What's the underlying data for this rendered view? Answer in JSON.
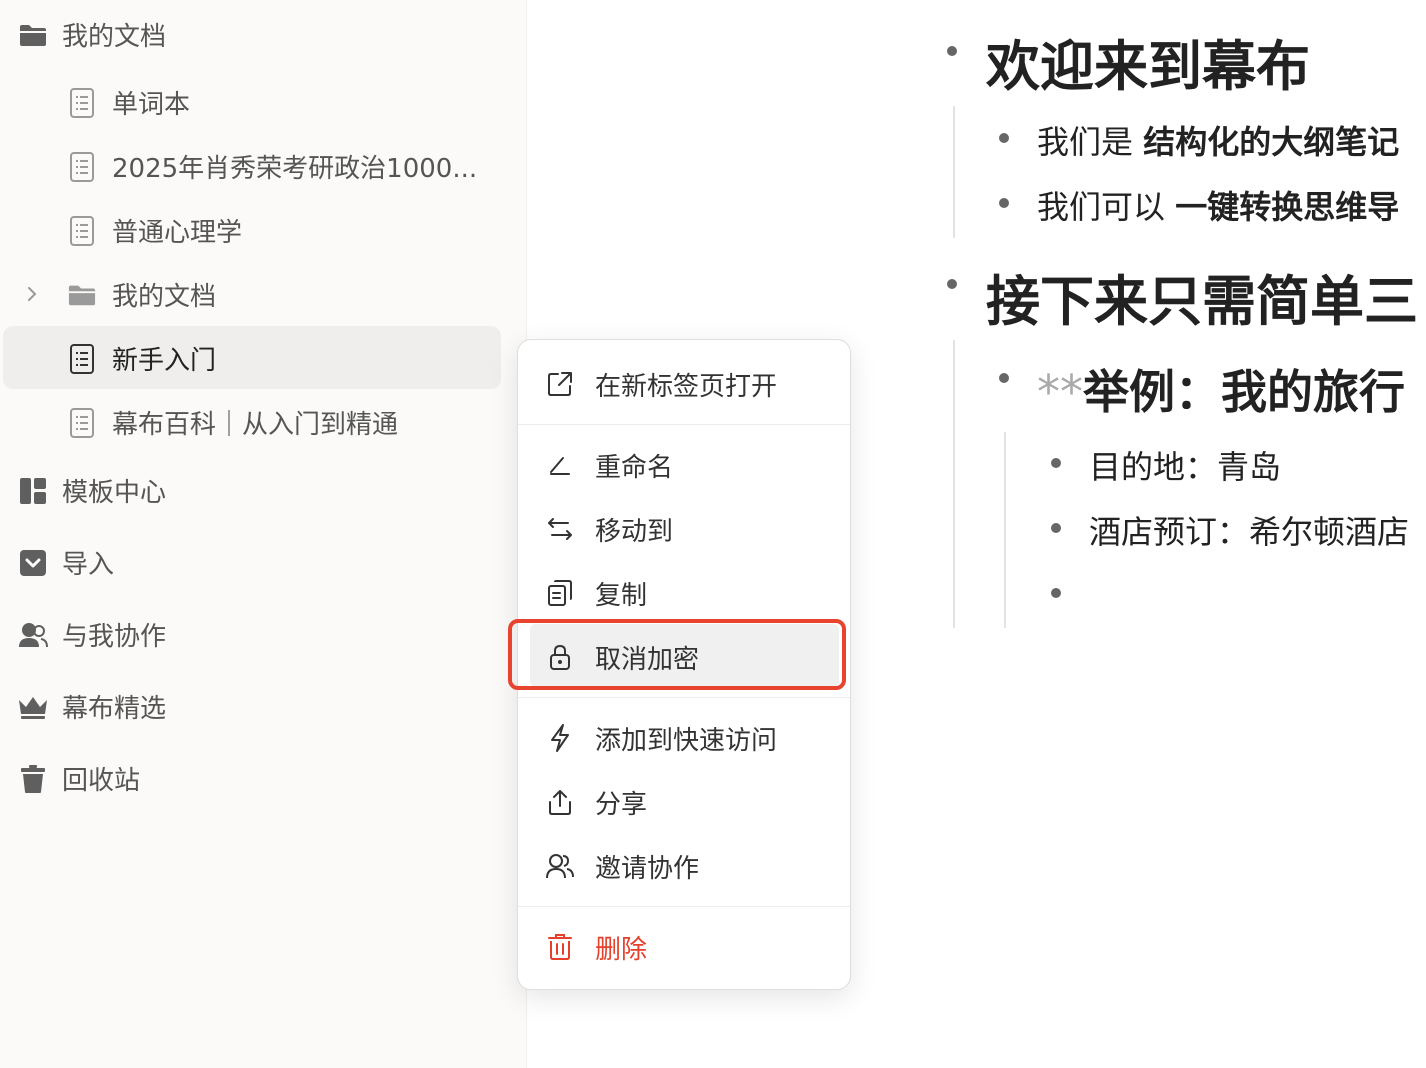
{
  "sidebar": {
    "root_folder": "我的文档",
    "children": [
      {
        "label": "单词本",
        "type": "doc"
      },
      {
        "label": "2025年肖秀荣考研政治1000...",
        "type": "doc"
      },
      {
        "label": "普通心理学",
        "type": "doc"
      },
      {
        "label": "我的文档",
        "type": "folder"
      },
      {
        "label": "新手入门",
        "type": "doc",
        "active": true
      },
      {
        "label": "幕布百科｜从入门到精通",
        "type": "doc"
      }
    ],
    "nav": [
      {
        "label": "模板中心",
        "icon": "template-icon"
      },
      {
        "label": "导入",
        "icon": "import-icon"
      },
      {
        "label": "与我协作",
        "icon": "collaborate-icon"
      },
      {
        "label": "幕布精选",
        "icon": "crown-icon"
      },
      {
        "label": "回收站",
        "icon": "trash-icon"
      }
    ]
  },
  "document": {
    "h1": "欢迎来到幕布",
    "line1_prefix": "我们是 ",
    "line1_bold": "结构化的大纲笔记",
    "line2_prefix": "我们可以 ",
    "line2_bold": "一键转换思维导",
    "h1b": "接下来只需简单三",
    "example_stars": "**",
    "example_title": "举例：我的旅行",
    "dest": "目的地：青岛",
    "hotel": "酒店预订：希尔顿酒店"
  },
  "context_menu": {
    "open_new_tab": "在新标签页打开",
    "rename": "重命名",
    "move_to": "移动到",
    "copy": "复制",
    "decrypt": "取消加密",
    "add_quick_access": "添加到快速访问",
    "share": "分享",
    "invite": "邀请协作",
    "delete": "删除"
  },
  "colors": {
    "accent_red": "#e8432e",
    "danger_text": "#e5402c",
    "sidebar_bg": "#fbfaf8"
  }
}
